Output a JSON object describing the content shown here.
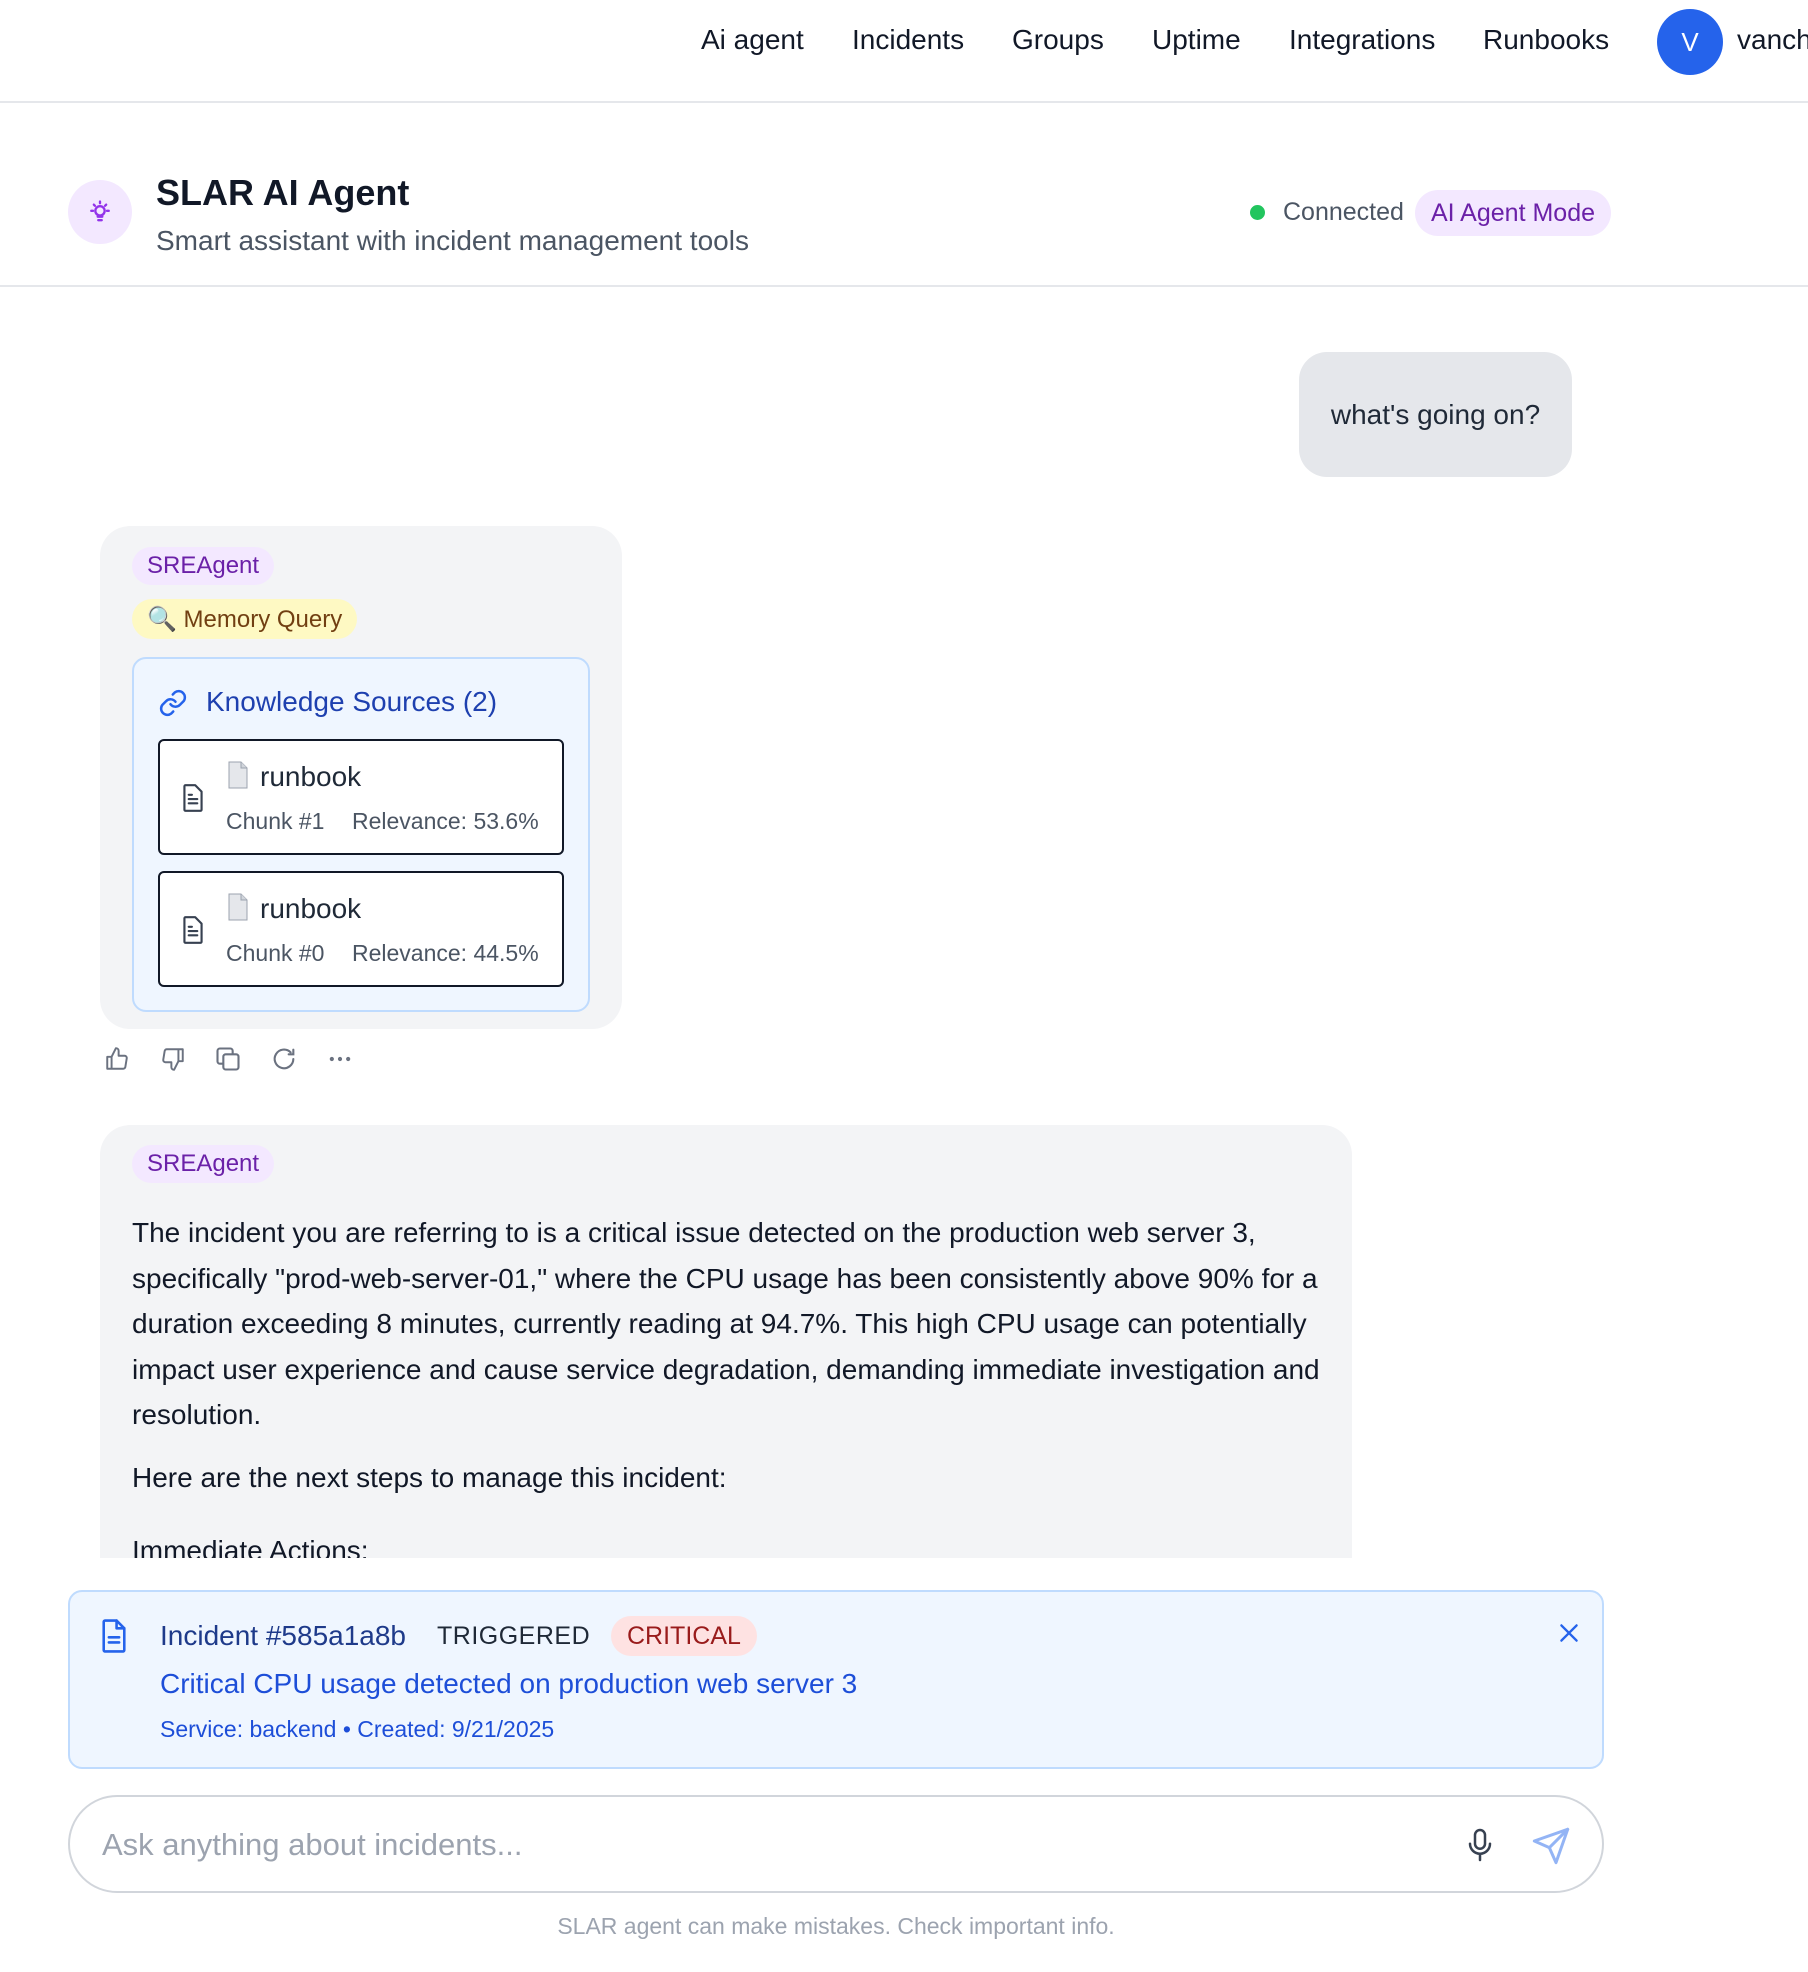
{
  "nav": {
    "links": [
      "Ai agent",
      "Incidents",
      "Groups",
      "Uptime",
      "Integrations",
      "Runbooks"
    ],
    "avatar_initial": "V",
    "username": "vanch"
  },
  "header": {
    "title": "SLAR AI Agent",
    "subtitle": "Smart assistant with incident management tools",
    "status": "Connected",
    "mode": "AI Agent Mode",
    "icon": "lightbulb-icon"
  },
  "chat": {
    "user_message": "what's going on?",
    "agent_card_1": {
      "agent_label": "SREAgent",
      "tool_label": "🔍 Memory Query",
      "knowledge_title": "Knowledge Sources (2)",
      "sources": [
        {
          "name": "runbook",
          "chunk": "Chunk #1",
          "relevance": "Relevance: 53.6%"
        },
        {
          "name": "runbook",
          "chunk": "Chunk #0",
          "relevance": "Relevance: 44.5%"
        }
      ]
    },
    "actions": [
      "thumbs-up-icon",
      "thumbs-down-icon",
      "copy-icon",
      "regenerate-icon",
      "more-icon"
    ],
    "agent_card_2": {
      "agent_label": "SREAgent",
      "paragraph_1": "The incident you are referring to is a critical issue detected on the production web server 3, specifically \"prod-web-server-01,\" where the CPU usage has been consistently above 90% for a duration exceeding 8 minutes, currently reading at 94.7%. This high CPU usage can potentially impact user experience and cause service degradation, demanding immediate investigation and resolution.",
      "paragraph_2": "Here are the next steps to manage this incident:",
      "paragraph_3": "Immediate Actions:"
    }
  },
  "incident": {
    "id": "Incident #585a1a8b",
    "status": "TRIGGERED",
    "severity": "CRITICAL",
    "title": "Critical CPU usage detected on production web server 3",
    "meta": "Service: backend • Created: 9/21/2025"
  },
  "input": {
    "placeholder": "Ask anything about incidents..."
  },
  "disclaimer": "SLAR agent can make mistakes. Check important info.",
  "colors": {
    "accent": "#2563eb",
    "purple_badge_bg": "#f3e8ff",
    "purple_badge_text": "#6b21a8",
    "status_green": "#22c55e",
    "critical_bg": "#fee2e2",
    "critical_text": "#991b1b"
  }
}
